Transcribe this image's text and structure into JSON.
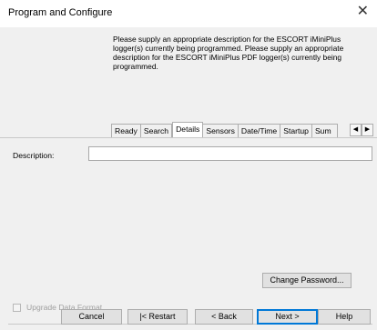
{
  "window": {
    "title": "Program and Configure",
    "close_glyph": "✕"
  },
  "instructions": "Please supply an appropriate description for the ESCORT iMiniPlus logger(s) currently being programmed. Please supply an appropriate description for the ESCORT iMiniPlus PDF logger(s) currently being programmed.",
  "tabs": [
    {
      "label": "Ready"
    },
    {
      "label": "Search"
    },
    {
      "label": "Details",
      "active": true
    },
    {
      "label": "Sensors"
    },
    {
      "label": "Date/Time"
    },
    {
      "label": "Startup"
    },
    {
      "label": "Sum"
    }
  ],
  "tab_scroll": {
    "left": "◀",
    "right": "▶"
  },
  "description": {
    "label": "Description:",
    "value": ""
  },
  "upgrade": {
    "label": "Upgrade Data Format",
    "checked": false,
    "enabled": false
  },
  "buttons": {
    "change_password": "Change Password...",
    "cancel": "Cancel",
    "restart": "|< Restart",
    "back": "< Back",
    "next": "Next >",
    "help": "Help"
  }
}
